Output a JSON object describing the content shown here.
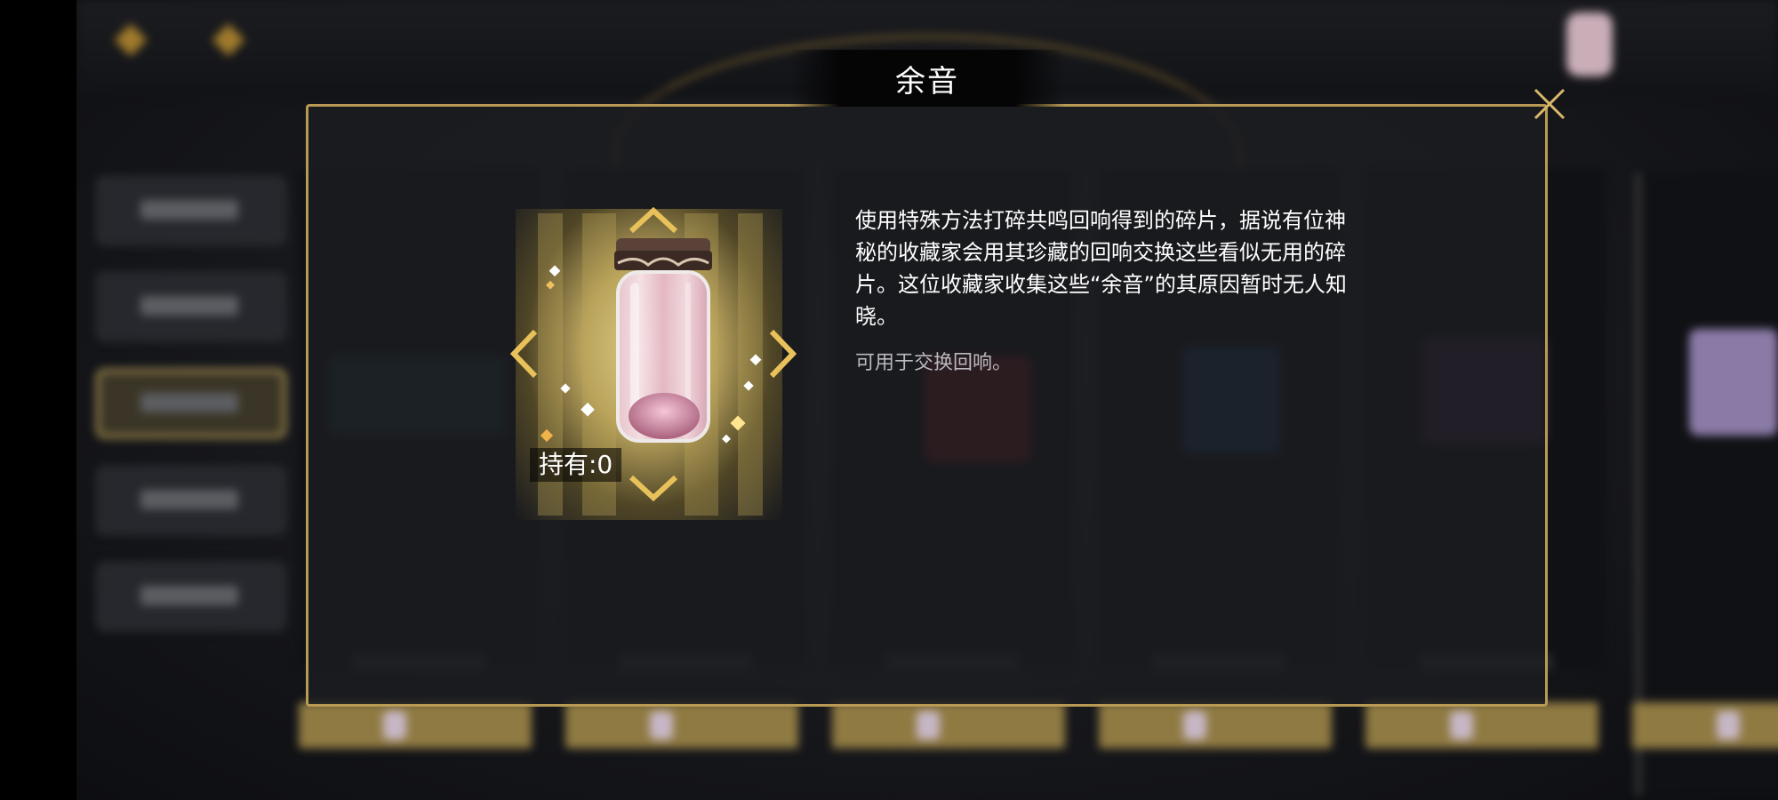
{
  "dialog": {
    "title": "余音",
    "close_icon": "close-icon",
    "item": {
      "icon": "glass-jar-icon",
      "held_label": "持有:0"
    },
    "description": "使用特殊方法打碎共鸣回响得到的碎片，据说有位神秘的收藏家会用其珍藏的回响交换这些看似无用的碎片。这位收藏家收集这些“余音”的其原因暂时无人知晓。",
    "usage": "可用于交换回响。"
  },
  "colors": {
    "frame_gold": "#b89a55",
    "accent_gold": "#e8c15a",
    "title_bar": "#050506",
    "usage_text": "#b9b9bf"
  }
}
